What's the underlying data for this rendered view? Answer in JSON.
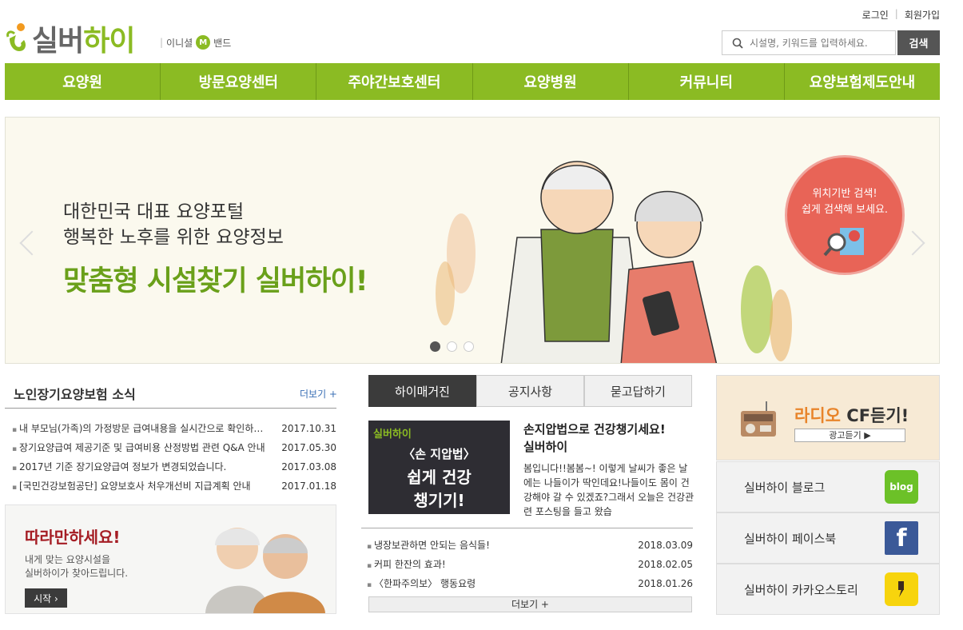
{
  "header": {
    "login": "로그인",
    "signup": "회원가입",
    "logo_main": "실버",
    "logo_accent": "하이",
    "band": [
      "이니셜",
      "M",
      "밴드"
    ],
    "search_placeholder": "시설명, 키워드를 입력하세요.",
    "search_button": "검색"
  },
  "nav": [
    "요양원",
    "방문요양센터",
    "주야간보호센터",
    "요양병원",
    "커뮤니티",
    "요양보험제도안내"
  ],
  "banner": {
    "line1": "대한민국 대표 요양포털",
    "line2": "행복한 노후를 위한 요양정보",
    "headline": "맞춤형 시설찾기 실버하이!",
    "bubble_line1": "위치기반 검색!",
    "bubble_line2": "쉽게 검색해 보세요."
  },
  "news": {
    "title": "노인장기요양보험 소식",
    "more": "더보기 +",
    "items": [
      {
        "title": "내 부모님(가족)의 가정방문 급여내용을 실시간으로 확인하세요",
        "date": "2017.10.31"
      },
      {
        "title": "장기요양급여 제공기준 및 급여비용 산정방법 관련 Q&A 안내",
        "date": "2017.05.30"
      },
      {
        "title": "2017년 기준 장기요양급여 정보가 변경되었습니다.",
        "date": "2017.03.08"
      },
      {
        "title": "[국민건강보험공단] 요양보호사 처우개선비 지급계획 안내",
        "date": "2017.01.18"
      }
    ]
  },
  "follow": {
    "title": "따라만하세요!",
    "line1": "내게 맞는 요양시설을",
    "line2": "실버하이가 찾아드립니다.",
    "start": "시작 ›"
  },
  "magazine": {
    "tabs": [
      "하이매거진",
      "공지사항",
      "묻고답하기"
    ],
    "thumb_logo": "실버하이",
    "thumb_line1": "〈손 지압법〉",
    "thumb_line2": "쉽게 건강",
    "thumb_line3": "챙기기!",
    "head1": "손지압법으로 건강챙기세요!",
    "head2": "실버하이",
    "body": "봄입니다!!봄봄~! 이렇게 날씨가 좋은 날에는 나들이가 딱인데요!나들이도 몸이 건강해야 갈 수 있겠죠?그래서 오늘은 건강관련 포스팅을 들고 왔습",
    "items": [
      {
        "title": "냉장보관하면 안되는 음식들!",
        "date": "2018.03.09"
      },
      {
        "title": "커피 한잔의 효과!",
        "date": "2018.02.05"
      },
      {
        "title": "〈한파주의보〉 행동요령",
        "date": "2018.01.26"
      }
    ],
    "more": "더보기 +"
  },
  "side": {
    "radio_accent": "라디오",
    "radio_rest": " CF듣기!",
    "radio_button": "광고듣기 ▶",
    "blog": "실버하이 블로그",
    "blog_icon": "blog",
    "facebook": "실버하이 페이스북",
    "facebook_icon": "f",
    "kakao": "실버하이 카카오스토리"
  }
}
